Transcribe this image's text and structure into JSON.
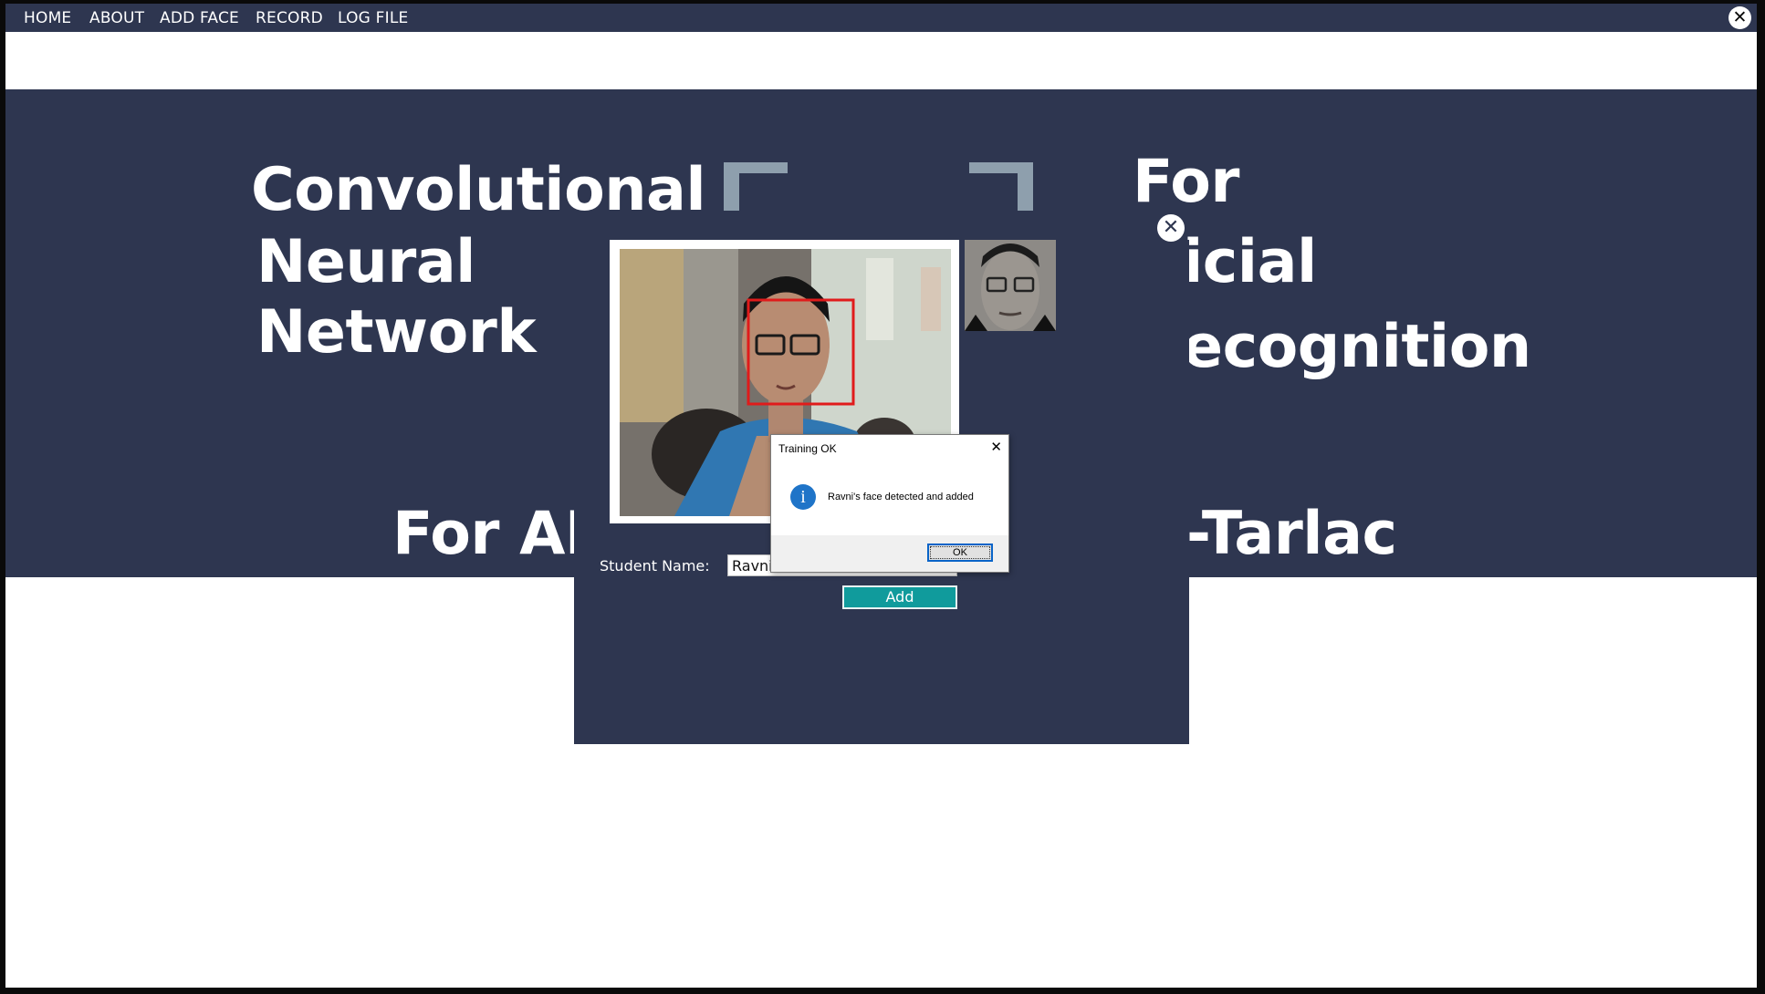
{
  "menu": {
    "items": [
      "HOME",
      "ABOUT",
      "ADD FACE",
      "RECORD",
      "LOG FILE"
    ],
    "close_icon": "close-circle-icon"
  },
  "hero": {
    "left_lines": [
      "Convolutional",
      "Neural",
      "Network"
    ],
    "right_lines": [
      "For",
      "icial",
      "ecognition"
    ],
    "bottom_left": "For AM",
    "bottom_right": "-Tarlac"
  },
  "add_face_popup": {
    "student_name_label": "Student Name:",
    "student_name_value": "Ravni",
    "add_button": "Add",
    "close_icon": "close-circle-icon"
  },
  "dialog": {
    "title": "Training OK",
    "message": "Ravni's face detected and added",
    "ok_button": "OK",
    "icon": "info-icon"
  },
  "colors": {
    "navy": "#2e3650",
    "teal": "#109b9c",
    "detection_box": "#e01b1b"
  }
}
